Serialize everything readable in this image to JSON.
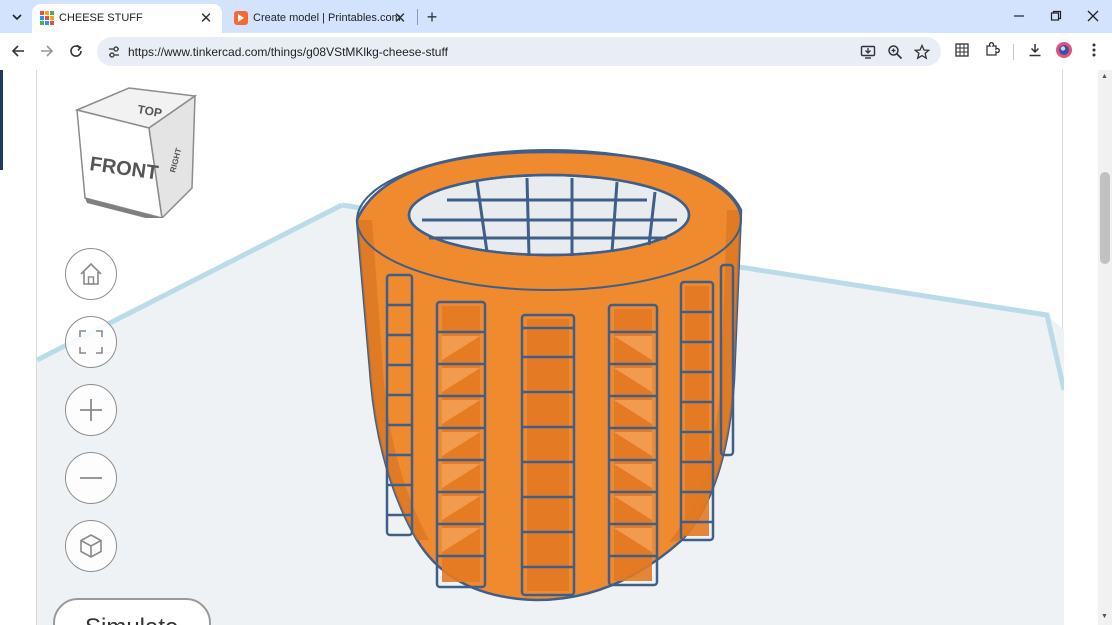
{
  "browser": {
    "tabs": [
      {
        "title": "CHEESE STUFF",
        "active": true,
        "favicon": "tinkercad-grid-icon"
      },
      {
        "title": "Create model | Printables.com",
        "active": false,
        "favicon": "printables-icon"
      }
    ],
    "url": "https://www.tinkercad.com/things/g08VStMKlkg-cheese-stuff"
  },
  "viewcube": {
    "top_label": "TOP",
    "front_label": "FRONT",
    "right_label": "RIGHT"
  },
  "view_controls": [
    {
      "name": "home-view",
      "icon": "home-icon"
    },
    {
      "name": "fit-view",
      "icon": "fit-to-view-icon"
    },
    {
      "name": "zoom-in",
      "icon": "plus-icon"
    },
    {
      "name": "zoom-out",
      "icon": "minus-icon"
    },
    {
      "name": "perspective",
      "icon": "cube-icon"
    }
  ],
  "simulate_button": {
    "label": "Simulate"
  },
  "colors": {
    "model_orange": "#f08a2e",
    "model_edge": "#3f5f8a",
    "chrome_blue": "#d3e3fd"
  }
}
